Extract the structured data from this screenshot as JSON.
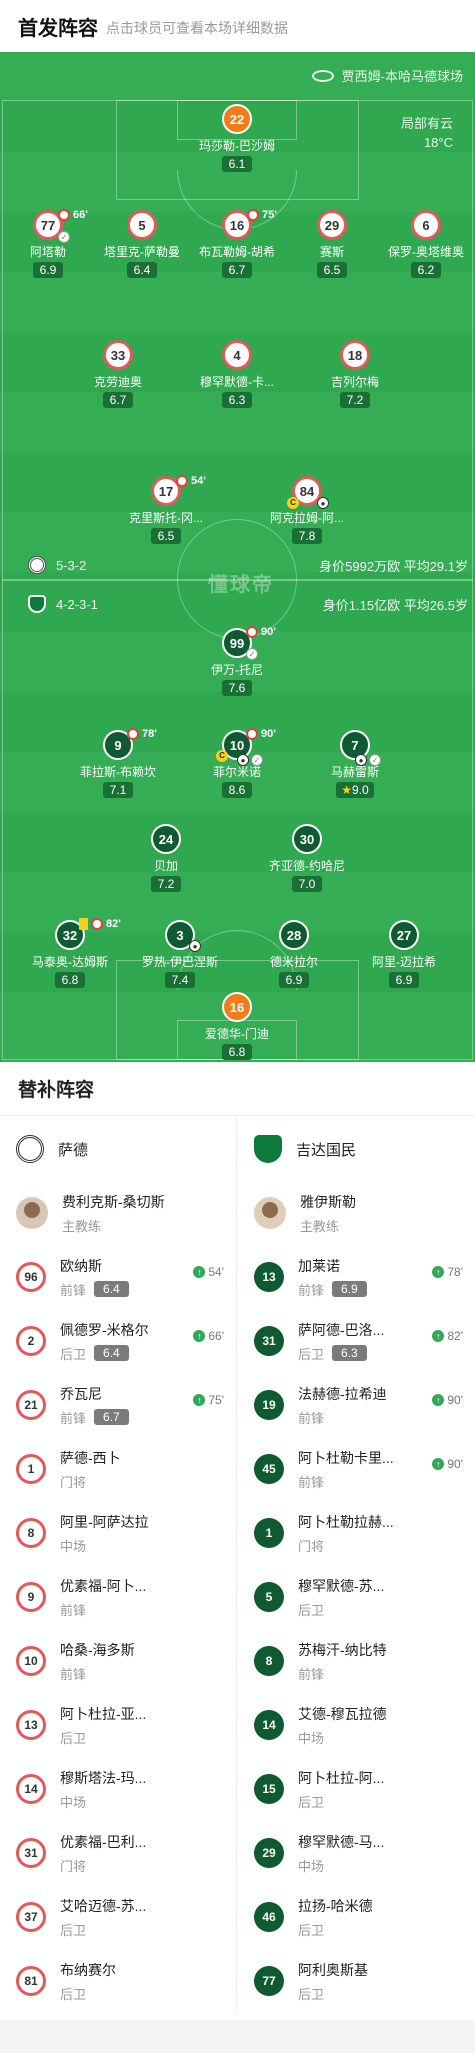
{
  "header": {
    "title": "首发阵容",
    "hint": "点击球员可查看本场详细数据"
  },
  "venue": "贾西姆-本哈马德球场",
  "weather": {
    "desc": "局部有云",
    "temp": "18°C"
  },
  "watermark": "懂球帝",
  "home_team": {
    "formation": "5-3-2",
    "stats": "身价5992万欧  平均29.1岁"
  },
  "away_team": {
    "formation": "4-2-3-1",
    "stats": "身价1.15亿欧  平均26.5岁"
  },
  "home_players": [
    {
      "num": "22",
      "name": "玛莎勒-巴沙姆",
      "rating": "6.1"
    },
    {
      "num": "77",
      "name": "阿塔勒",
      "rating": "6.9",
      "sub_min": "66'"
    },
    {
      "num": "5",
      "name": "塔里克-萨勒曼",
      "rating": "6.4"
    },
    {
      "num": "16",
      "name": "布瓦勒姆-胡希",
      "rating": "6.7",
      "sub_min": "75'"
    },
    {
      "num": "29",
      "name": "赛斯",
      "rating": "6.5"
    },
    {
      "num": "6",
      "name": "保罗-奥塔维奥",
      "rating": "6.2"
    },
    {
      "num": "33",
      "name": "克劳迪奥",
      "rating": "6.7"
    },
    {
      "num": "4",
      "name": "穆罕默德-卡...",
      "rating": "6.3"
    },
    {
      "num": "18",
      "name": "吉列尔梅",
      "rating": "7.2"
    },
    {
      "num": "17",
      "name": "克里斯托-冈...",
      "rating": "6.5",
      "sub_min": "54'"
    },
    {
      "num": "84",
      "name": "阿克拉姆-阿...",
      "rating": "7.8"
    }
  ],
  "away_players": [
    {
      "num": "99",
      "name": "伊万-托尼",
      "rating": "7.6",
      "sub_min": "90'"
    },
    {
      "num": "9",
      "name": "菲拉斯-布赖坎",
      "rating": "7.1",
      "sub_min": "78'"
    },
    {
      "num": "10",
      "name": "菲尔米诺",
      "rating": "8.6",
      "sub_min": "90'"
    },
    {
      "num": "7",
      "name": "马赫雷斯",
      "rating": "9.0"
    },
    {
      "num": "24",
      "name": "贝加",
      "rating": "7.2"
    },
    {
      "num": "30",
      "name": "齐亚德-约哈尼",
      "rating": "7.0"
    },
    {
      "num": "32",
      "name": "马泰奥-达姆斯",
      "rating": "6.8",
      "sub_min": "82'"
    },
    {
      "num": "3",
      "name": "罗热-伊巴涅斯",
      "rating": "7.4"
    },
    {
      "num": "28",
      "name": "德米拉尔",
      "rating": "6.9"
    },
    {
      "num": "27",
      "name": "阿里-迈拉希",
      "rating": "6.9"
    },
    {
      "num": "16",
      "name": "爱德华-门迪",
      "rating": "6.8"
    }
  ],
  "subs": {
    "title": "替补阵容",
    "home": {
      "team": "萨德",
      "coach": {
        "name": "费利克斯-桑切斯",
        "role": "主教练"
      },
      "rows": [
        {
          "num": "96",
          "name": "欧纳斯",
          "pos": "前锋",
          "rating": "6.4",
          "in": "54'"
        },
        {
          "num": "2",
          "name": "佩德罗-米格尔",
          "pos": "后卫",
          "rating": "6.4",
          "in": "66'"
        },
        {
          "num": "21",
          "name": "乔瓦尼",
          "pos": "前锋",
          "rating": "6.7",
          "in": "75'"
        },
        {
          "num": "1",
          "name": "萨德-西卜",
          "pos": "门将"
        },
        {
          "num": "8",
          "name": "阿里-阿萨达拉",
          "pos": "中场"
        },
        {
          "num": "9",
          "name": "优素福-阿卜...",
          "pos": "前锋"
        },
        {
          "num": "10",
          "name": "哈桑-海多斯",
          "pos": "前锋"
        },
        {
          "num": "13",
          "name": "阿卜杜拉-亚...",
          "pos": "后卫"
        },
        {
          "num": "14",
          "name": "穆斯塔法-玛...",
          "pos": "中场"
        },
        {
          "num": "31",
          "name": "优素福-巴利...",
          "pos": "门将"
        },
        {
          "num": "37",
          "name": "艾哈迈德-苏...",
          "pos": "后卫"
        },
        {
          "num": "81",
          "name": "布纳赛尔",
          "pos": "后卫"
        }
      ]
    },
    "away": {
      "team": "吉达国民",
      "coach": {
        "name": "雅伊斯勒",
        "role": "主教练"
      },
      "rows": [
        {
          "num": "13",
          "name": "加莱诺",
          "pos": "前锋",
          "rating": "6.9",
          "in": "78'"
        },
        {
          "num": "31",
          "name": "萨阿德-巴洛...",
          "pos": "后卫",
          "rating": "6.3",
          "in": "82'"
        },
        {
          "num": "19",
          "name": "法赫德-拉希迪",
          "pos": "前锋",
          "in": "90'"
        },
        {
          "num": "45",
          "name": "阿卜杜勒卡里...",
          "pos": "前锋",
          "in": "90'"
        },
        {
          "num": "1",
          "name": "阿卜杜勒拉赫...",
          "pos": "门将"
        },
        {
          "num": "5",
          "name": "穆罕默德-苏...",
          "pos": "后卫"
        },
        {
          "num": "8",
          "name": "苏梅汗-纳比特",
          "pos": "前锋"
        },
        {
          "num": "14",
          "name": "艾德-穆瓦拉德",
          "pos": "中场"
        },
        {
          "num": "15",
          "name": "阿卜杜拉-阿...",
          "pos": "后卫"
        },
        {
          "num": "29",
          "name": "穆罕默德-马...",
          "pos": "中场"
        },
        {
          "num": "46",
          "name": "拉扬-哈米德",
          "pos": "后卫"
        },
        {
          "num": "77",
          "name": "阿利奥斯基",
          "pos": "后卫"
        }
      ]
    }
  }
}
